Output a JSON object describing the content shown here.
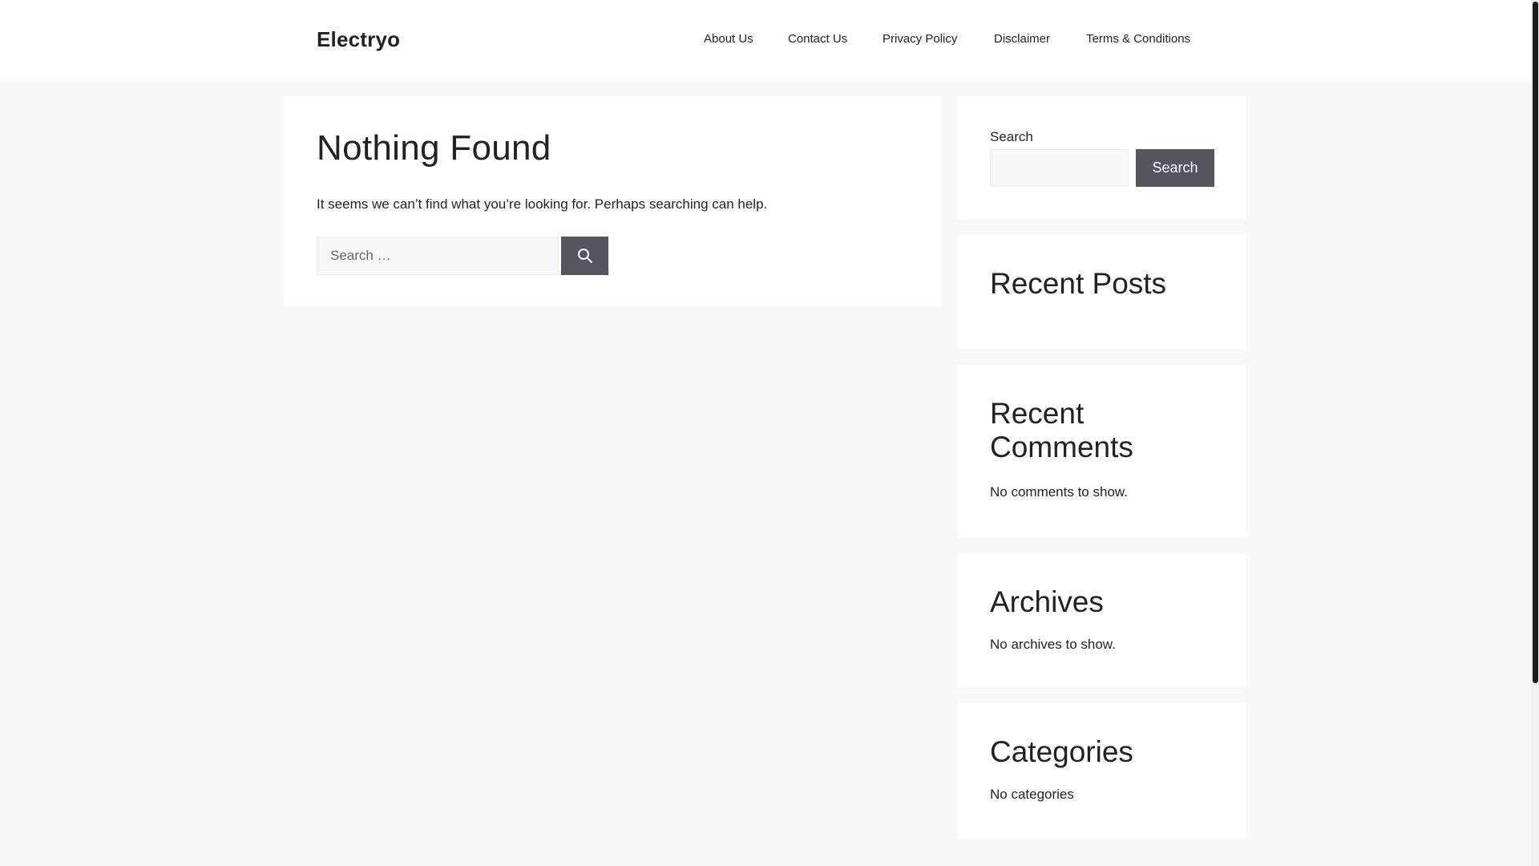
{
  "site": {
    "title": "Electryo"
  },
  "nav": {
    "items": [
      {
        "label": "About Us"
      },
      {
        "label": "Contact Us"
      },
      {
        "label": "Privacy Policy"
      },
      {
        "label": "Disclaimer"
      },
      {
        "label": "Terms & Conditions"
      }
    ]
  },
  "main": {
    "title": "Nothing Found",
    "text": "It seems we can’t find what you’re looking for. Perhaps searching can help.",
    "search_placeholder": "Search …",
    "search_value": "",
    "search_icon": "search-icon"
  },
  "sidebar": {
    "search": {
      "label": "Search",
      "input_value": "",
      "button_label": "Search"
    },
    "recent_posts": {
      "title": "Recent Posts"
    },
    "recent_comments": {
      "title": "Recent Comments",
      "text": "No comments to show."
    },
    "archives": {
      "title": "Archives",
      "text": "No archives to show."
    },
    "categories": {
      "title": "Categories",
      "text": "No categories"
    }
  },
  "colors": {
    "page_background": "#f7f8f9",
    "card_background": "#ffffff",
    "button_background": "#55555e",
    "text": "#222222"
  }
}
